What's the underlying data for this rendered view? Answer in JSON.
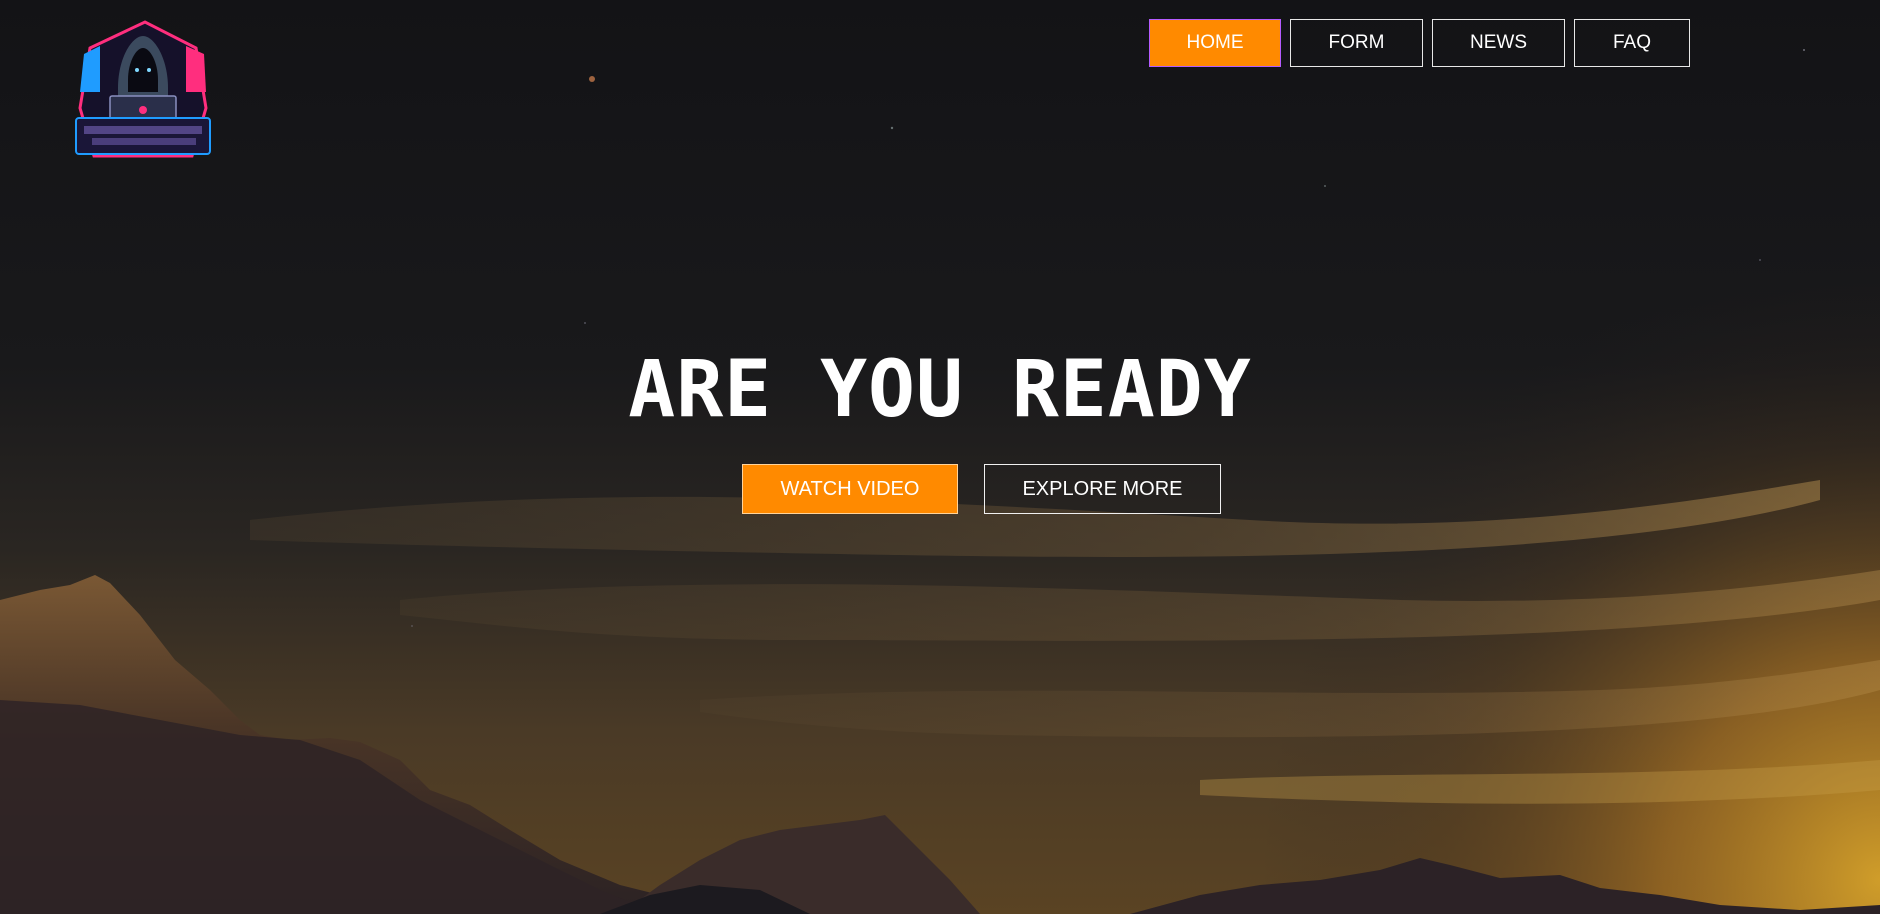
{
  "nav": {
    "items": [
      {
        "label": "HOME",
        "active": true
      },
      {
        "label": "FORM",
        "active": false
      },
      {
        "label": "NEWS",
        "active": false
      },
      {
        "label": "FAQ",
        "active": false
      }
    ]
  },
  "hero": {
    "title": "ARE YOU READY",
    "primary_button": "WATCH VIDEO",
    "secondary_button": "EXPLORE MORE"
  },
  "logo": {
    "icon": "hooded-hacker-logo"
  },
  "colors": {
    "accent": "#ff8a00",
    "background": "#121214",
    "text": "#ffffff"
  }
}
